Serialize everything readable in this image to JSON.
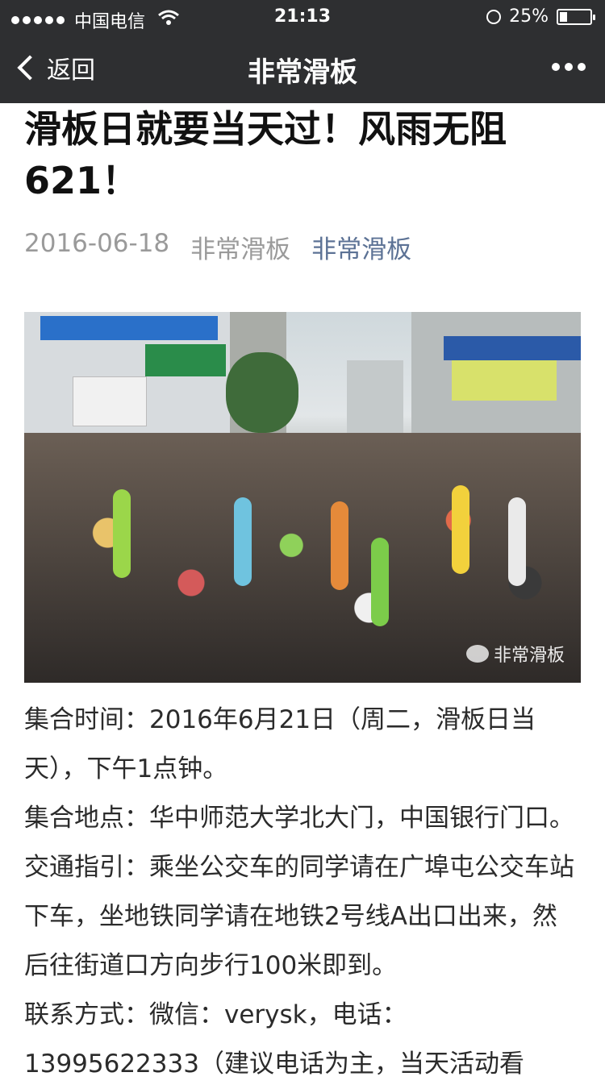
{
  "status_bar": {
    "carrier": "中国电信",
    "time": "21:13",
    "battery_percent": "25%",
    "battery_level": 0.25
  },
  "nav": {
    "back_label": "返回",
    "title": "非常滑板"
  },
  "article": {
    "title": "滑板日就要当天过！风雨无阻621！",
    "date": "2016-06-18",
    "author": "非常滑板",
    "account": "非常滑板",
    "image_watermark": "非常滑板",
    "paragraphs": [
      "集合时间：2016年6月21日（周二，滑板日当天），下午1点钟。",
      "集合地点：华中师范大学北大门，中国银行门口。",
      "交通指引：乘坐公交车的同学请在广埠屯公交车站下车，坐地铁同学请在地铁2号线A出口出来，然后往街道口方向步行100米即到。",
      "联系方式：微信：verysk，电话：13995622333（建议电话为主，当天活动看"
    ]
  }
}
